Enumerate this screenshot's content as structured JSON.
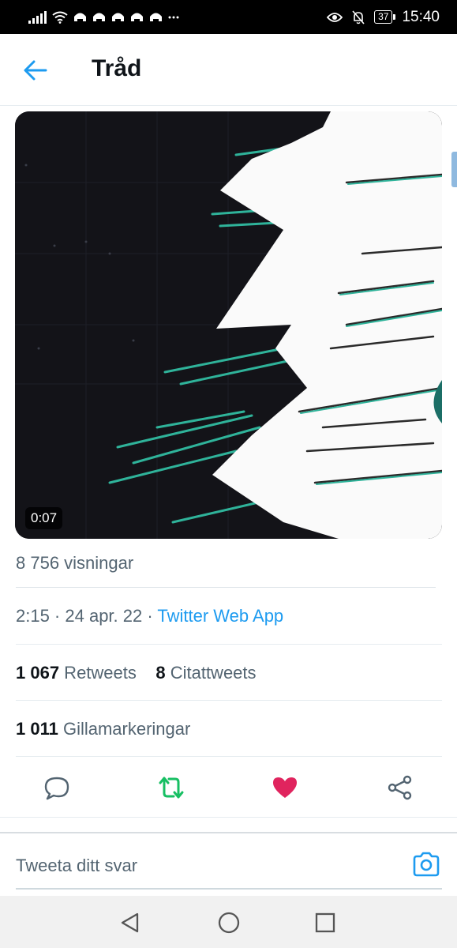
{
  "status_bar": {
    "time": "15:40",
    "battery": "37",
    "notification_icons": [
      "signal-icon",
      "wifi-icon",
      "app-notification-icon",
      "app-notification-icon",
      "app-notification-icon",
      "app-notification-icon",
      "app-notification-icon",
      "more-icon"
    ],
    "right_icons": [
      "eye-icon",
      "bell-off-icon",
      "battery-icon"
    ]
  },
  "header": {
    "title": "Tråd",
    "back_icon": "arrow-left-icon"
  },
  "tweet": {
    "video_duration": "0:07",
    "views": "8 756 visningar",
    "time_date": "2:15 · 24 apr. 22 · ",
    "source": "Twitter Web App",
    "retweets_count": "1 067",
    "retweets_label": " Retweets",
    "quotes_count": "8",
    "quotes_label": " Citattweets",
    "likes_count": "1 011",
    "likes_label": " Gillamarkeringar"
  },
  "actions": [
    {
      "icon": "reply-icon"
    },
    {
      "icon": "retweet-icon",
      "color": "#17bf63"
    },
    {
      "icon": "heart-icon",
      "color": "#e0245e"
    },
    {
      "icon": "share-icon"
    }
  ],
  "reply": {
    "placeholder": "Tweeta ditt svar",
    "camera_icon": "camera-icon"
  },
  "nav": {
    "icons": [
      "back-triangle-icon",
      "home-circle-icon",
      "recents-square-icon"
    ]
  },
  "colors": {
    "accent": "#1d9bf0",
    "retweet_green": "#17bf63",
    "like_red": "#e0245e",
    "secondary_text": "#536471"
  }
}
